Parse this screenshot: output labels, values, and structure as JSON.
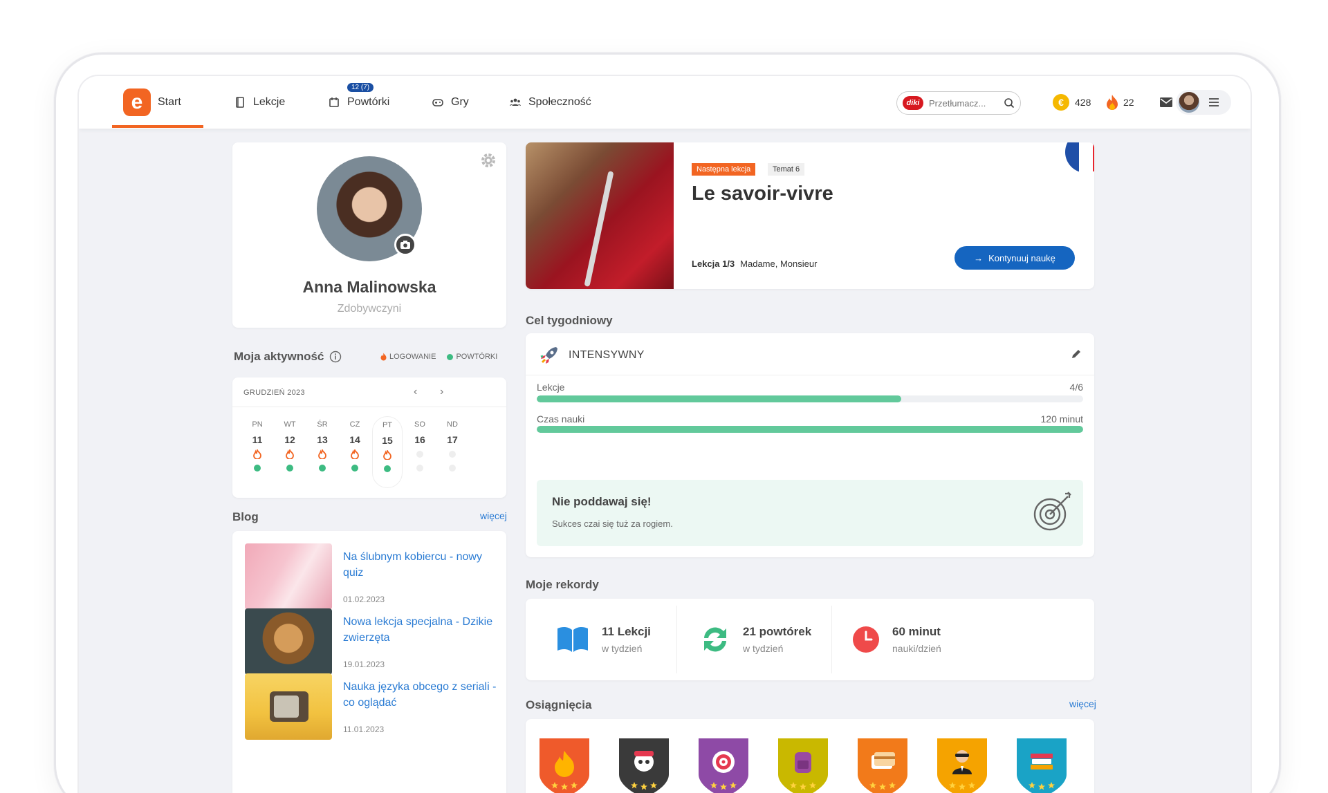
{
  "nav": {
    "start": "Start",
    "lekcje": "Lekcje",
    "powtorki": "Powtórki",
    "powtorki_badge": "12 (7)",
    "gry": "Gry",
    "spolecznosc": "Społeczność",
    "logo_letter": "e",
    "search_placeholder": "Przetłumacz...",
    "diki": "diki",
    "coins": "428",
    "coin_symbol": "€",
    "streak": "22"
  },
  "profile": {
    "name": "Anna Malinowska",
    "level": "Zdobywczyni"
  },
  "activity": {
    "title": "Moja aktywność",
    "legend_login": "LOGOWANIE",
    "legend_review": "POWTÓRKI",
    "month": "GRUDZIEŃ 2023",
    "days": [
      {
        "name": "PN",
        "date": "11",
        "login": true,
        "review": true
      },
      {
        "name": "WT",
        "date": "12",
        "login": true,
        "review": true
      },
      {
        "name": "ŚR",
        "date": "13",
        "login": true,
        "review": true
      },
      {
        "name": "CZ",
        "date": "14",
        "login": true,
        "review": true
      },
      {
        "name": "PT",
        "date": "15",
        "login": true,
        "review": true
      },
      {
        "name": "SO",
        "date": "16",
        "login": false,
        "review": false
      },
      {
        "name": "ND",
        "date": "17",
        "login": false,
        "review": false
      }
    ]
  },
  "blog": {
    "title": "Blog",
    "more": "więcej",
    "items": [
      {
        "title": "Na ślubnym kobiercu - nowy quiz",
        "date": "01.02.2023"
      },
      {
        "title": "Nowa lekcja specjalna - Dzikie zwierzęta",
        "date": "19.01.2023"
      },
      {
        "title": "Nauka języka obcego z seriali - co oglądać",
        "date": "11.01.2023"
      }
    ]
  },
  "lesson": {
    "tag_next": "Następna lekcja",
    "tag_topic": "Temat 6",
    "title": "Le savoir-vivre",
    "lesson_num": "Lekcja 1/3",
    "lesson_name": "Madame, Monsieur",
    "button": "Kontynuuj naukę",
    "flag_colors": [
      "#1f4fa8",
      "#ffffff",
      "#e8252d"
    ]
  },
  "goal": {
    "section": "Cel tygodniowy",
    "mode": "INTENSYWNY",
    "lessons_label": "Lekcje",
    "lessons_value": "4/6",
    "lessons_progress": 0.667,
    "time_label": "Czas nauki",
    "time_value": "120 minut",
    "time_progress": 1.0,
    "tip_title": "Nie poddawaj się!",
    "tip_sub": "Sukces czai się tuż za rogiem."
  },
  "records": {
    "section": "Moje rekordy",
    "items": [
      {
        "main": "11 Lekcji",
        "sub": "w tydzień",
        "icon": "book-icon"
      },
      {
        "main": "21 powtórek",
        "sub": "w tydzień",
        "icon": "repeat-icon"
      },
      {
        "main": "60 minut",
        "sub": "nauki/dzień",
        "icon": "clock-icon"
      }
    ]
  },
  "achievements": {
    "section": "Osiągnięcia",
    "more": "więcej",
    "badges": [
      {
        "icon": "flame-badge-icon",
        "color": "#ef5a2b"
      },
      {
        "icon": "pirate-badge-icon",
        "color": "#3a3a3a"
      },
      {
        "icon": "target-badge-icon",
        "color": "#8e4aa6"
      },
      {
        "icon": "backpack-badge-icon",
        "color": "#c9b800"
      },
      {
        "icon": "cards-badge-icon",
        "color": "#f27a1a"
      },
      {
        "icon": "agent-badge-icon",
        "color": "#f5a300"
      },
      {
        "icon": "books-badge-icon",
        "color": "#1aa3c6"
      }
    ]
  }
}
